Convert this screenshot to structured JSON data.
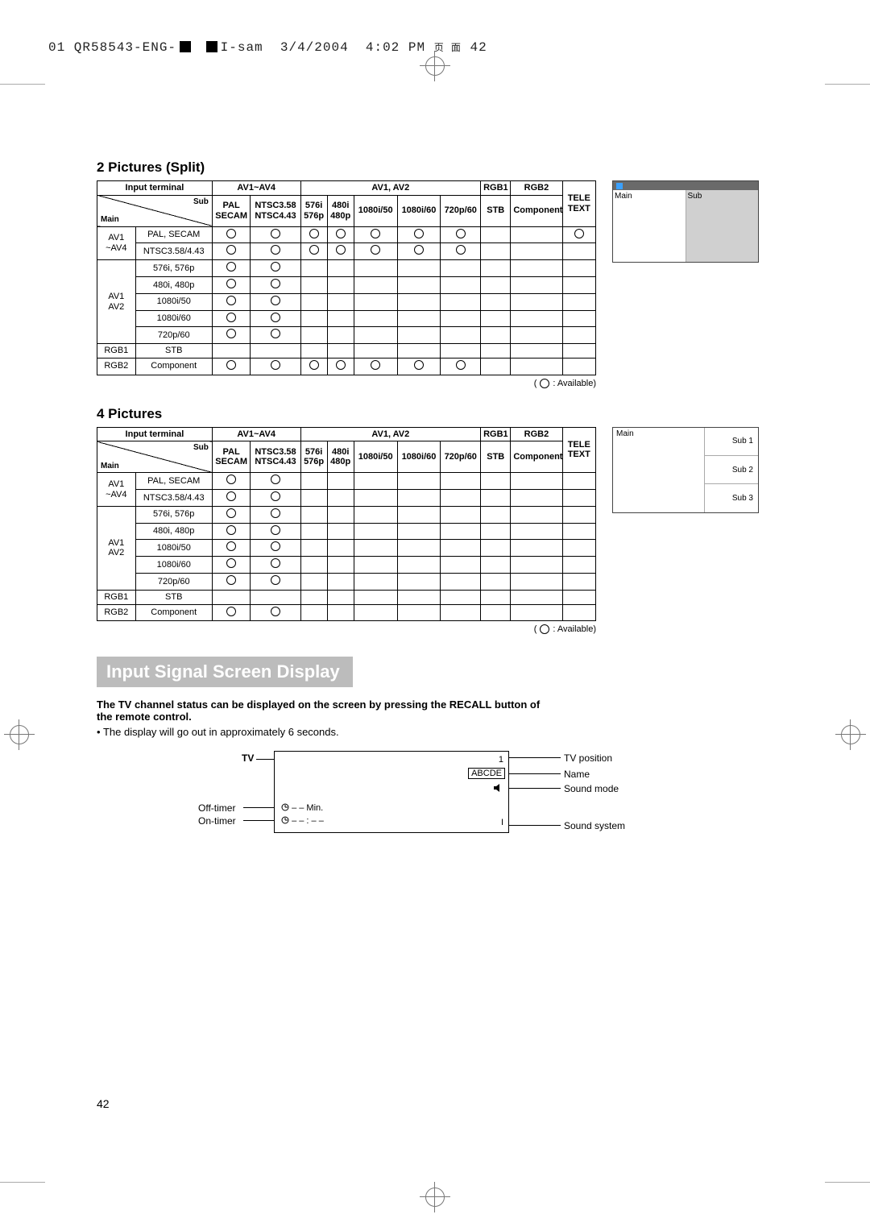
{
  "print_header": {
    "prefix": "01 QR58543-ENG-",
    "mid": "I-sam",
    "date": "3/4/2004",
    "time": "4:02 PM",
    "page_marker": "42"
  },
  "section_2pic_title": "2 Pictures (Split)",
  "section_4pic_title": "4 Pictures",
  "table_corner_sub": "Sub",
  "table_corner_main": "Main",
  "table_input_terminal": "Input terminal",
  "group_av14": "AV1~AV4",
  "group_av12": "AV1, AV2",
  "col_rgb1": "RGB1",
  "col_rgb2": "RGB2",
  "col_teletext_l1": "TELE",
  "col_teletext_l2": "TEXT",
  "col_pal_l1": "PAL",
  "col_pal_l2": "SECAM",
  "col_ntsc_l1": "NTSC3.58",
  "col_ntsc_l2": "NTSC4.43",
  "col_576i_l1": "576i",
  "col_576i_l2": "576p",
  "col_480i_l1": "480i",
  "col_480i_l2": "480p",
  "col_1080i50": "1080i/50",
  "col_1080i60": "1080i/60",
  "col_720p60": "720p/60",
  "col_stb": "STB",
  "col_component": "Component",
  "legend_avail": ": Available)",
  "legend_open": "(",
  "rows2": [
    {
      "main_l1": "AV1",
      "main_l2": "~AV4",
      "sub": "PAL, SECAM",
      "marks": [
        "o",
        "o",
        "o",
        "o",
        "o",
        "o",
        "o",
        "",
        "",
        "o"
      ]
    },
    {
      "main_l1": "",
      "main_l2": "",
      "sub": "NTSC3.58/4.43",
      "marks": [
        "o",
        "o",
        "o",
        "o",
        "o",
        "o",
        "o",
        "",
        "",
        ""
      ]
    },
    {
      "main_l1": "",
      "main_l2": "",
      "sub": "576i, 576p",
      "marks": [
        "o",
        "o",
        "",
        "",
        "",
        "",
        "",
        "",
        "",
        ""
      ]
    },
    {
      "main_l1": "",
      "main_l2": "",
      "sub": "480i, 480p",
      "marks": [
        "o",
        "o",
        "",
        "",
        "",
        "",
        "",
        "",
        "",
        ""
      ]
    },
    {
      "main_l1": "AV1",
      "main_l2": "AV2",
      "sub": "1080i/50",
      "marks": [
        "o",
        "o",
        "",
        "",
        "",
        "",
        "",
        "",
        "",
        ""
      ]
    },
    {
      "main_l1": "",
      "main_l2": "",
      "sub": "1080i/60",
      "marks": [
        "o",
        "o",
        "",
        "",
        "",
        "",
        "",
        "",
        "",
        ""
      ]
    },
    {
      "main_l1": "",
      "main_l2": "",
      "sub": "720p/60",
      "marks": [
        "o",
        "o",
        "",
        "",
        "",
        "",
        "",
        "",
        "",
        ""
      ]
    },
    {
      "main_l1": "RGB1",
      "main_l2": "",
      "sub": "STB",
      "marks": [
        "",
        "",
        "",
        "",
        "",
        "",
        "",
        "",
        "",
        ""
      ]
    },
    {
      "main_l1": "RGB2",
      "main_l2": "",
      "sub": "Component",
      "marks": [
        "o",
        "o",
        "o",
        "o",
        "o",
        "o",
        "o",
        "",
        "",
        ""
      ]
    }
  ],
  "rows4": [
    {
      "main_l1": "AV1",
      "main_l2": "~AV4",
      "sub": "PAL, SECAM",
      "marks": [
        "o",
        "o",
        "",
        "",
        "",
        "",
        "",
        "",
        "",
        ""
      ]
    },
    {
      "main_l1": "",
      "main_l2": "",
      "sub": "NTSC3.58/4.43",
      "marks": [
        "o",
        "o",
        "",
        "",
        "",
        "",
        "",
        "",
        "",
        ""
      ]
    },
    {
      "main_l1": "",
      "main_l2": "",
      "sub": "576i, 576p",
      "marks": [
        "o",
        "o",
        "",
        "",
        "",
        "",
        "",
        "",
        "",
        ""
      ]
    },
    {
      "main_l1": "",
      "main_l2": "",
      "sub": "480i, 480p",
      "marks": [
        "o",
        "o",
        "",
        "",
        "",
        "",
        "",
        "",
        "",
        ""
      ]
    },
    {
      "main_l1": "AV1",
      "main_l2": "AV2",
      "sub": "1080i/50",
      "marks": [
        "o",
        "o",
        "",
        "",
        "",
        "",
        "",
        "",
        "",
        ""
      ]
    },
    {
      "main_l1": "",
      "main_l2": "",
      "sub": "1080i/60",
      "marks": [
        "o",
        "o",
        "",
        "",
        "",
        "",
        "",
        "",
        "",
        ""
      ]
    },
    {
      "main_l1": "",
      "main_l2": "",
      "sub": "720p/60",
      "marks": [
        "o",
        "o",
        "",
        "",
        "",
        "",
        "",
        "",
        "",
        ""
      ]
    },
    {
      "main_l1": "RGB1",
      "main_l2": "",
      "sub": "STB",
      "marks": [
        "",
        "",
        "",
        "",
        "",
        "",
        "",
        "",
        "",
        ""
      ]
    },
    {
      "main_l1": "RGB2",
      "main_l2": "",
      "sub": "Component",
      "marks": [
        "o",
        "o",
        "",
        "",
        "",
        "",
        "",
        "",
        "",
        ""
      ]
    }
  ],
  "preview2": {
    "main": "Main",
    "sub": "Sub"
  },
  "preview4": {
    "main": "Main",
    "sub1": "Sub 1",
    "sub2": "Sub 2",
    "sub3": "Sub 3"
  },
  "banner": "Input Signal Screen Display",
  "lead": "The TV channel status can be displayed on the screen by pressing the RECALL button of the remote control.",
  "subline_bullet": "•",
  "subline": "The display will go out in approximately 6 seconds.",
  "osd": {
    "tv": "TV",
    "tv1": "1",
    "abcde": "ABCDE",
    "off_icon_text": "– – Min.",
    "on_icon_text": "– – : – –",
    "i": "I",
    "tv_position": "TV position",
    "name": "Name",
    "sound_mode": "Sound mode",
    "off_timer": "Off-timer",
    "on_timer": "On-timer",
    "sound_system": "Sound system"
  },
  "page_number": "42",
  "chart_data": {
    "type": "table",
    "title": "PIP / Multi-picture input compatibility",
    "legend": "○ : Available",
    "columns": [
      "PAL/SECAM",
      "NTSC3.58/NTSC4.43",
      "576i/576p",
      "480i/480p",
      "1080i/50",
      "1080i/60",
      "720p/60",
      "STB",
      "Component",
      "TELETEXT"
    ],
    "tables": [
      {
        "name": "2 Pictures (Split)",
        "rows": [
          {
            "main": "AV1~AV4",
            "sub": "PAL, SECAM",
            "available": [
              1,
              1,
              1,
              1,
              1,
              1,
              1,
              0,
              0,
              1
            ]
          },
          {
            "main": "AV1~AV4",
            "sub": "NTSC3.58/4.43",
            "available": [
              1,
              1,
              1,
              1,
              1,
              1,
              1,
              0,
              0,
              0
            ]
          },
          {
            "main": "AV1/AV2",
            "sub": "576i, 576p",
            "available": [
              1,
              1,
              0,
              0,
              0,
              0,
              0,
              0,
              0,
              0
            ]
          },
          {
            "main": "AV1/AV2",
            "sub": "480i, 480p",
            "available": [
              1,
              1,
              0,
              0,
              0,
              0,
              0,
              0,
              0,
              0
            ]
          },
          {
            "main": "AV1/AV2",
            "sub": "1080i/50",
            "available": [
              1,
              1,
              0,
              0,
              0,
              0,
              0,
              0,
              0,
              0
            ]
          },
          {
            "main": "AV1/AV2",
            "sub": "1080i/60",
            "available": [
              1,
              1,
              0,
              0,
              0,
              0,
              0,
              0,
              0,
              0
            ]
          },
          {
            "main": "AV1/AV2",
            "sub": "720p/60",
            "available": [
              1,
              1,
              0,
              0,
              0,
              0,
              0,
              0,
              0,
              0
            ]
          },
          {
            "main": "RGB1",
            "sub": "STB",
            "available": [
              0,
              0,
              0,
              0,
              0,
              0,
              0,
              0,
              0,
              0
            ]
          },
          {
            "main": "RGB2",
            "sub": "Component",
            "available": [
              1,
              1,
              1,
              1,
              1,
              1,
              1,
              0,
              0,
              0
            ]
          }
        ]
      },
      {
        "name": "4 Pictures",
        "rows": [
          {
            "main": "AV1~AV4",
            "sub": "PAL, SECAM",
            "available": [
              1,
              1,
              0,
              0,
              0,
              0,
              0,
              0,
              0,
              0
            ]
          },
          {
            "main": "AV1~AV4",
            "sub": "NTSC3.58/4.43",
            "available": [
              1,
              1,
              0,
              0,
              0,
              0,
              0,
              0,
              0,
              0
            ]
          },
          {
            "main": "AV1/AV2",
            "sub": "576i, 576p",
            "available": [
              1,
              1,
              0,
              0,
              0,
              0,
              0,
              0,
              0,
              0
            ]
          },
          {
            "main": "AV1/AV2",
            "sub": "480i, 480p",
            "available": [
              1,
              1,
              0,
              0,
              0,
              0,
              0,
              0,
              0,
              0
            ]
          },
          {
            "main": "AV1/AV2",
            "sub": "1080i/50",
            "available": [
              1,
              1,
              0,
              0,
              0,
              0,
              0,
              0,
              0,
              0
            ]
          },
          {
            "main": "AV1/AV2",
            "sub": "1080i/60",
            "available": [
              1,
              1,
              0,
              0,
              0,
              0,
              0,
              0,
              0,
              0
            ]
          },
          {
            "main": "AV1/AV2",
            "sub": "720p/60",
            "available": [
              1,
              1,
              0,
              0,
              0,
              0,
              0,
              0,
              0,
              0
            ]
          },
          {
            "main": "RGB1",
            "sub": "STB",
            "available": [
              0,
              0,
              0,
              0,
              0,
              0,
              0,
              0,
              0,
              0
            ]
          },
          {
            "main": "RGB2",
            "sub": "Component",
            "available": [
              1,
              1,
              0,
              0,
              0,
              0,
              0,
              0,
              0,
              0
            ]
          }
        ]
      }
    ]
  }
}
